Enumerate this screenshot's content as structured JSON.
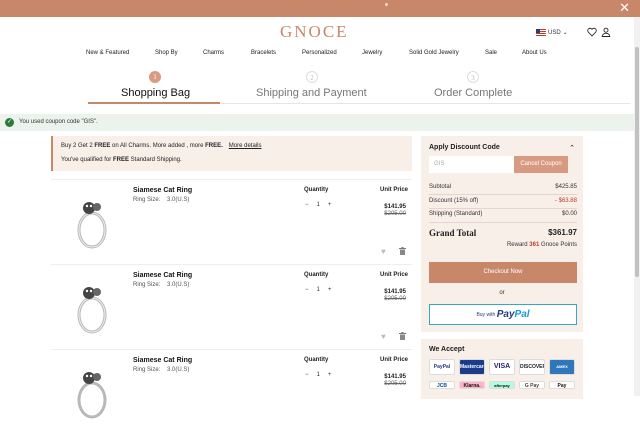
{
  "header": {
    "logo": "GNOCE",
    "currency": "USD",
    "nav": [
      "New & Featured",
      "Shop By",
      "Charms",
      "Bracelets",
      "Personalized",
      "Jewelry",
      "Solid Gold Jewelry",
      "Sale",
      "About Us"
    ]
  },
  "steps": [
    {
      "num": "1",
      "label": "Shopping Bag",
      "active": true
    },
    {
      "num": "2",
      "label": "Shipping and Payment",
      "active": false
    },
    {
      "num": "3",
      "label": "Order Complete",
      "active": false
    }
  ],
  "coupon_notice": "You used coupon code \"GIS\".",
  "promo": {
    "line1_pre": "Buy 2 Get 2 ",
    "line1_bold1": "FREE",
    "line1_mid": " on All Charms. More added , more ",
    "line1_bold2": "FREE.",
    "line1_link": "More details",
    "line2_pre": "You've qualified for ",
    "line2_bold": "FREE",
    "line2_post": " Standard Shipping."
  },
  "items": [
    {
      "name": "Siamese Cat Ring",
      "size_label": "Ring Size:",
      "size": "3.0(U.S)",
      "qty_label": "Quantity",
      "qty": "1",
      "unit_label": "Unit Price",
      "price": "$141.95",
      "old_price": "$205.00"
    },
    {
      "name": "Siamese Cat Ring",
      "size_label": "Ring Size:",
      "size": "3.0(U.S)",
      "qty_label": "Quantity",
      "qty": "1",
      "unit_label": "Unit Price",
      "price": "$141.95",
      "old_price": "$205.00"
    },
    {
      "name": "Siamese Cat Ring",
      "size_label": "Ring Size:",
      "size": "3.0(U.S)",
      "qty_label": "Quantity",
      "qty": "1",
      "unit_label": "Unit Price",
      "price": "$141.95",
      "old_price": "$205.00"
    }
  ],
  "summary": {
    "discount_title": "Apply Discount Code",
    "coupon_placeholder": "GIS",
    "cancel_coupon": "Cancel Coupon",
    "subtotal_label": "Subtotal",
    "subtotal": "$425.85",
    "discount_label": "Discount (15% off)",
    "discount": "- $63.88",
    "shipping_label": "Shipping (Standard)",
    "shipping": "$0.00",
    "grand_label": "Grand Total",
    "grand": "$361.97",
    "reward_pre": "Reward ",
    "reward_points": "361",
    "reward_post": " Gnoce Points",
    "checkout": "Checkout Now",
    "or": "or",
    "paypal_pre": "Buy with",
    "paypal_1": "Pay",
    "paypal_2": "Pal"
  },
  "accept": {
    "title": "We Accept",
    "cards": [
      "PayPal",
      "Mastercard",
      "VISA",
      "DISCOVER",
      "AMEX",
      "JCB",
      "Klarna.",
      "afterpay",
      "G Pay",
      "Pay"
    ]
  },
  "colors": {
    "accent": "#c9876a",
    "discount_red": "#c0392b",
    "panel_bg": "#f9efe9"
  }
}
